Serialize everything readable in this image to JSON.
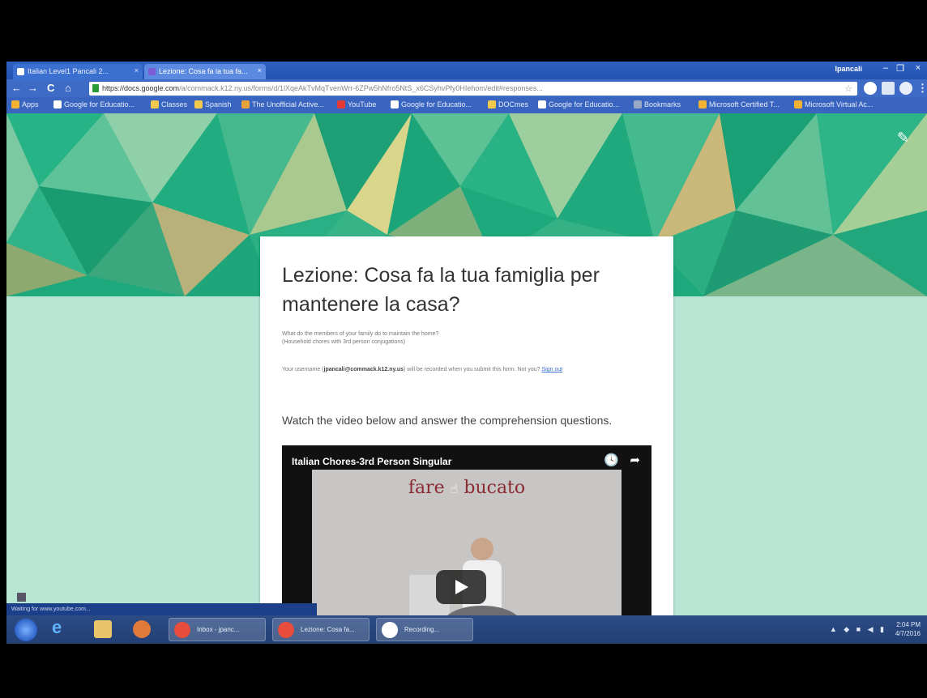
{
  "browser": {
    "tabs": [
      {
        "label": "Italian Level1 Pancali 2..."
      },
      {
        "label": "Lezione: Cosa fa la tua fa..."
      }
    ],
    "close_glyph": "×",
    "profile": "Ipancali",
    "window_controls": [
      "–",
      "❐",
      "×"
    ],
    "url_host": "https://docs.google.com",
    "url_path": "/a/commack.k12.ny.us/forms/d/1lXqeAkTvMqTvenWrr-6ZPw5hNfro5NtS_x6CSyhvPfy0HIehom/edit#responses...",
    "star_glyph": "☆",
    "bookmarks": [
      {
        "label": "Apps",
        "color": "#f2b233"
      },
      {
        "label": "Google for Educatio...",
        "color": "#ffffff"
      },
      {
        "label": "Classes",
        "color": "#f2c94c"
      },
      {
        "label": "Spanish",
        "color": "#f2c94c"
      },
      {
        "label": "The Unofficial Active...",
        "color": "#e8a23a"
      },
      {
        "label": "YouTube",
        "color": "#e53935"
      },
      {
        "label": "Google for Educatio...",
        "color": "#ffffff"
      },
      {
        "label": "DOCmes",
        "color": "#f2c94c"
      },
      {
        "label": "Google for Educatio...",
        "color": "#ffffff"
      },
      {
        "label": "Bookmarks",
        "color": "#9aa8c8"
      },
      {
        "label": "Microsoft Certified T...",
        "color": "#f2b233"
      },
      {
        "label": "Microsoft Virtual Ac...",
        "color": "#f2b233"
      }
    ]
  },
  "form": {
    "title": "Lezione: Cosa fa la tua famiglia per mantenere la casa?",
    "description_line1": "What do the members of your family do to maintain the home?",
    "description_line2": "(Household chores with 3rd person conjugations)",
    "notice_prefix": "Your username (",
    "notice_user": "jpancali@commack.k12.ny.us",
    "notice_suffix": ") will be recorded when you submit this form. Not you? ",
    "notice_link": "Sign out",
    "question": "Watch the video below and answer the comprehension questions.",
    "edit_glyph": "✎",
    "video": {
      "title": "Italian Chores-3rd Person Singular",
      "caption_left": "fare ",
      "caption_cursor": "☝",
      "caption_right": " bucato",
      "clock_glyph": "🕓",
      "share_glyph": "➦"
    }
  },
  "status_tooltip": "Waiting for www.youtube.com...",
  "taskbar": {
    "apps": [
      {
        "label": "Inbox - jpanc...",
        "color": "#e74c3c"
      },
      {
        "label": "Lezione: Cosa fa...",
        "color": "#e74c3c"
      },
      {
        "label": "Recording...",
        "color": "#ffffff"
      }
    ],
    "tray_glyphs": "▲ ◆ ■ ◀ ▮",
    "time": "2:04 PM",
    "date": "4/7/2016"
  },
  "colors": {
    "banner_base": "#1ea97c",
    "page_bg": "#b8e4d4",
    "chrome_blue": "#2f62c4"
  }
}
